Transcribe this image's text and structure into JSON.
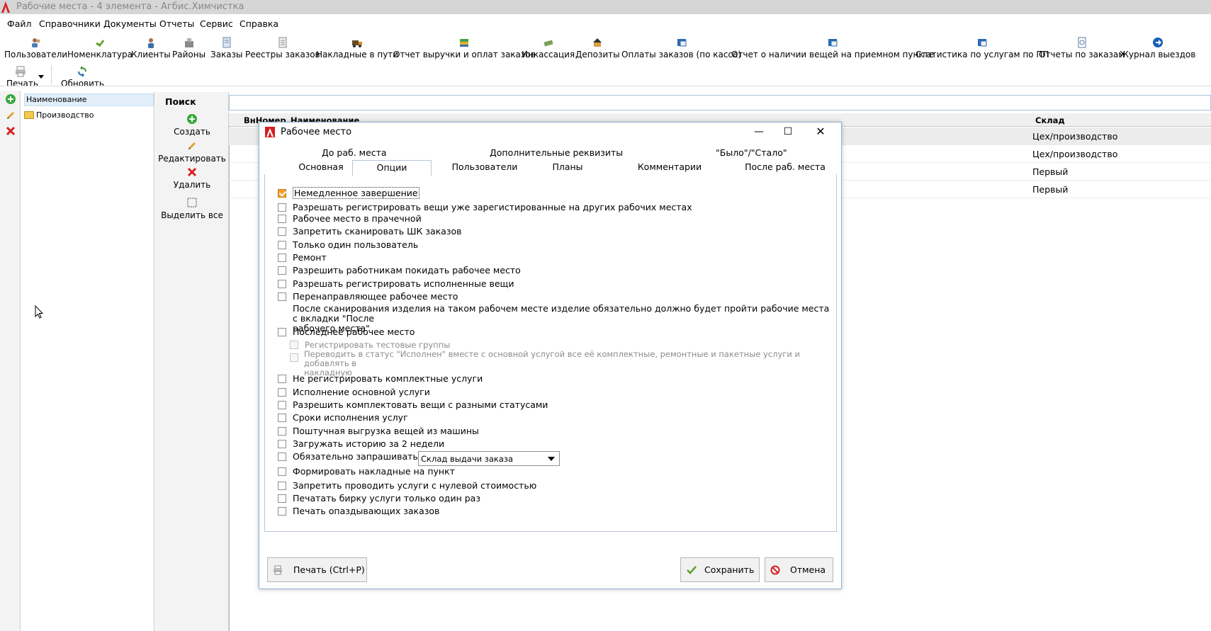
{
  "window": {
    "title": "Рабочие места - 4 элемента - Агбис.Химчистка"
  },
  "menu": [
    "Файл",
    "Справочники",
    "Документы",
    "Отчеты",
    "Сервис",
    "Справка"
  ],
  "toolbar": {
    "items": [
      {
        "label": "Пользователи",
        "icon": "users-icon"
      },
      {
        "label": "Номенклатура",
        "icon": "nomenclature-icon"
      },
      {
        "label": "Клиенты",
        "icon": "client-icon"
      },
      {
        "label": "Районы",
        "icon": "district-icon"
      },
      {
        "label": "Заказы",
        "icon": "orders-icon"
      },
      {
        "label": "Реестры заказов",
        "icon": "registry-icon"
      },
      {
        "label": "Накладные в пути",
        "icon": "truck-icon"
      },
      {
        "label": "Отчет выручки и оплат заказов",
        "icon": "report-icon"
      },
      {
        "label": "Инкассация",
        "icon": "collection-icon"
      },
      {
        "label": "Депозиты",
        "icon": "deposit-icon"
      },
      {
        "label": "Оплаты заказов (по кассе)",
        "icon": "payments-icon"
      },
      {
        "label": "Отчет о наличии вещей на приемном пункте",
        "icon": "stock-report-icon"
      },
      {
        "label": "Статистика по услугам по ПП",
        "icon": "stats-icon"
      },
      {
        "label": "Отчеты по заказам",
        "icon": "order-reports-icon"
      },
      {
        "label": "Журнал выездов",
        "icon": "arrow-right-icon"
      }
    ],
    "print_label": "Печать",
    "refresh_label": "Обновить"
  },
  "tree": {
    "header": "Наименование",
    "node": "Производство"
  },
  "search": {
    "label": "Поиск",
    "value": ""
  },
  "actions": {
    "create": "Создать",
    "edit": "Редактировать",
    "delete": "Удалить",
    "select_all": "Выделить все"
  },
  "grid": {
    "columns": [
      "ВнНомер",
      "Наименование",
      "Склад"
    ],
    "rows": [
      {
        "warehouse": "Цех/производство"
      },
      {
        "warehouse": "Цех/производство"
      },
      {
        "warehouse": "Первый"
      },
      {
        "warehouse": "Первый"
      }
    ]
  },
  "dialog": {
    "title": "Рабочее место",
    "tabs_top": [
      "До раб. места",
      "Дополнительные реквизиты",
      "\"Было\"/\"Стало\""
    ],
    "tabs": [
      "Основная",
      "Опции",
      "Пользователи",
      "Планы",
      "Комментарии",
      "После раб. места"
    ],
    "active_tab": "Опции",
    "options": [
      {
        "label": "Немедленное завершение",
        "checked": true
      },
      {
        "label": "Разрешать регистрировать вещи уже зарегистированные на других рабочих местах",
        "checked": false
      },
      {
        "label": "Рабочее место в прачечной",
        "checked": false
      },
      {
        "label": "Запретить сканировать ШК заказов",
        "checked": false
      },
      {
        "label": "Только один пользователь",
        "checked": false
      },
      {
        "label": "Ремонт",
        "checked": false
      },
      {
        "label": "Разрешить работникам покидать рабочее место",
        "checked": false
      },
      {
        "label": "Разрешать регистрировать исполненные вещи",
        "checked": false
      },
      {
        "label": "Перенаправляющее рабочее место",
        "checked": false
      }
    ],
    "redirect_note_line1": "После сканирования изделия на таком рабочем месте изделие обязательно должно будет пройти рабочие места с вкладки \"После",
    "redirect_note_line2": "рабочего места\"",
    "last_place": "Последнее рабочее место",
    "sub_options": {
      "test_groups": "Регистрировать тестовые группы",
      "transfer_line1": "Переводить в статус \"Исполнен\" вместе с основной услугой все её комплектные, ремонтные и пакетные услуги и добавлять в",
      "transfer_line2": "накладную"
    },
    "options2": [
      "Не регистрировать комплектные услуги",
      "Исполнение основной услуги",
      "Разрешить комплектовать вещи с разными статусами",
      "Сроки исполнения услуг",
      "Поштучная выгрузка вещей из машины",
      "Загружать историю за 2 недели",
      "Обязательно запрашивать комментарий при повторах"
    ],
    "invoice_label": "Формировать накладные на пункт",
    "invoice_combo": "Склад выдачи заказа",
    "options3": [
      "Запретить проводить услуги с нулевой стоимостью",
      "Печатать бирку услуги только один раз",
      "Печать опаздывающих заказов"
    ],
    "print_button": "Печать (Ctrl+P)",
    "save_button": "Сохранить",
    "cancel_button": "Отмена"
  }
}
